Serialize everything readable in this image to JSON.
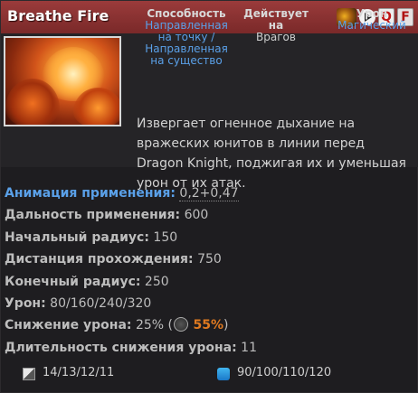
{
  "ability": {
    "title": "Breathe Fire",
    "hotkeys": [
      "Q",
      "F"
    ]
  },
  "properties": {
    "ability_header": "Способность",
    "ability_type": "Направленная на точку / Направленная на существо",
    "affects_header": "Действует на",
    "affects_value": "Врагов",
    "damage_header": "Урон",
    "damage_type": "Магический"
  },
  "description": "Извергает огненное дыхание на вражеских юнитов в линии перед Dragon Knight, поджигая их и уменьшая урон от их атак.",
  "stats": [
    {
      "label": "Анимация применения:",
      "value": "0,2+0,47"
    },
    {
      "label": "Дальность применения:",
      "value": "600"
    },
    {
      "label": "Начальный радиус:",
      "value": "150"
    },
    {
      "label": "Дистанция прохождения:",
      "value": "750"
    },
    {
      "label": "Конечный радиус:",
      "value": "250"
    },
    {
      "label": "Урон:",
      "value": "80/160/240/320"
    },
    {
      "label": "Снижение урона:",
      "value": "25% (",
      "extra": "55%",
      "close": ")"
    },
    {
      "label": "Длительность снижения урона:",
      "value": "11"
    }
  ],
  "cooldown": "14/13/12/11",
  "manacost": "90/100/110/120",
  "colors": {
    "header": "#8a3232",
    "accent_blue": "#5aa0e8",
    "accent_orange": "#e07a20",
    "mana": "#2a9ad8"
  },
  "icons": {
    "hero": "dragon-knight-portrait-icon",
    "play": "play-icon",
    "shard": "aghanims-shard-icon",
    "cooldown": "cooldown-icon",
    "mana": "mana-icon"
  }
}
